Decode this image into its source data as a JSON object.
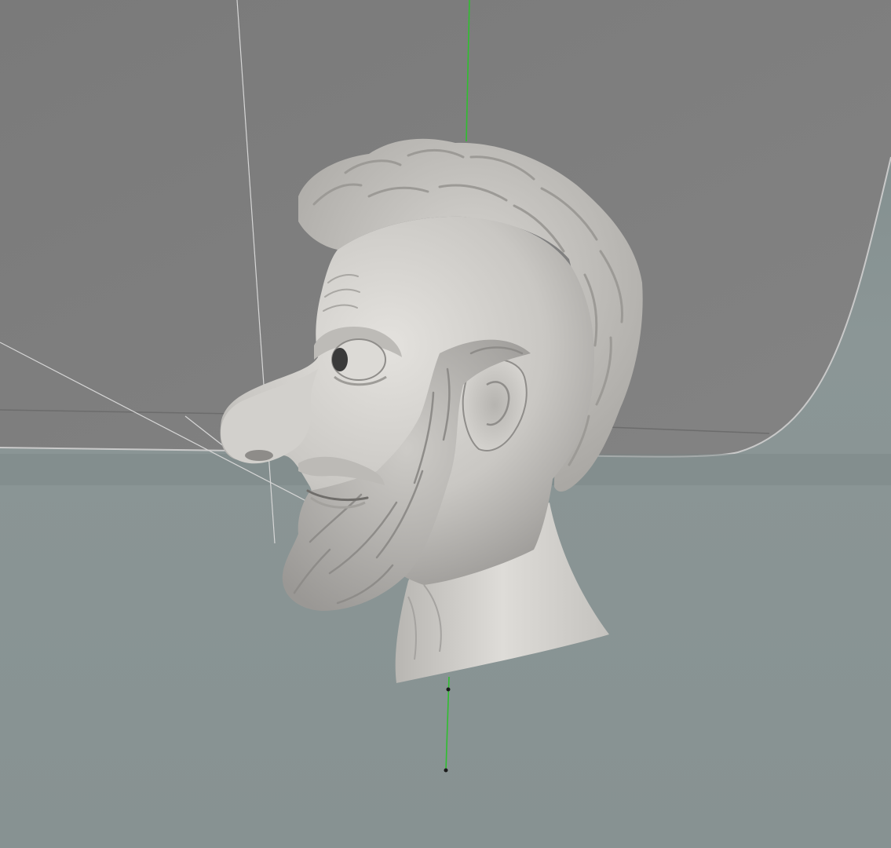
{
  "viewport": {
    "shading": "solid",
    "colors": {
      "backdrop_upper": "#7f7f7f",
      "backdrop_edge": "#c9c9c9",
      "floor": "#8a9595",
      "model": "#cfcdc9",
      "y_axis": "#2fbf2f",
      "guide_lines": "#d6d6d6"
    },
    "scene_objects": [
      {
        "name": "sculpted-head",
        "type": "mesh"
      },
      {
        "name": "backdrop-sweep",
        "type": "mesh"
      },
      {
        "name": "camera-guide-lines",
        "type": "guide"
      },
      {
        "name": "y-axis",
        "type": "axis"
      }
    ]
  }
}
